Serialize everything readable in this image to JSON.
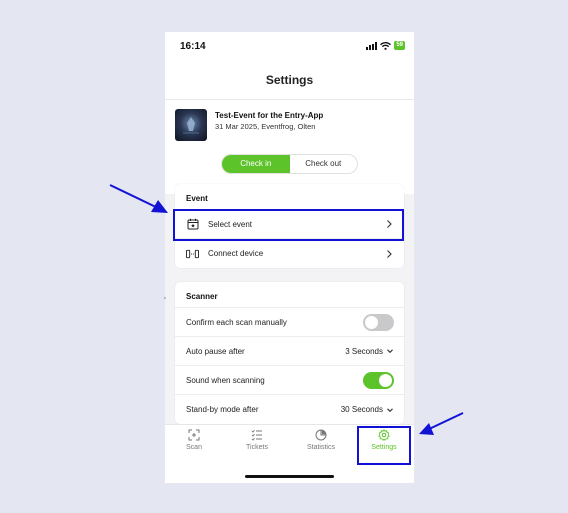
{
  "status_bar": {
    "time": "16:14",
    "battery": "59"
  },
  "header": {
    "title": "Settings"
  },
  "event": {
    "title": "Test-Event for the Entry-App",
    "subtitle": "31 Mar 2025, Eventfrog, Olten"
  },
  "segmented": {
    "checkin": "Check in",
    "checkout": "Check out",
    "selected": "checkin"
  },
  "event_section": {
    "heading": "Event",
    "items": [
      {
        "label": "Select event",
        "icon": "calendar-star-icon"
      },
      {
        "label": "Connect device",
        "icon": "connect-device-icon"
      }
    ]
  },
  "scanner_section": {
    "heading": "Scanner",
    "confirm_manual": {
      "label": "Confirm each scan manually",
      "enabled": false
    },
    "auto_pause": {
      "label": "Auto pause after",
      "value": "3 Seconds"
    },
    "sound": {
      "label": "Sound when scanning",
      "enabled": true
    },
    "standby": {
      "label": "Stand-by mode after",
      "value": "30 Seconds"
    }
  },
  "tabs": [
    {
      "label": "Scan",
      "icon": "scan-icon"
    },
    {
      "label": "Tickets",
      "icon": "tickets-list-icon"
    },
    {
      "label": "Statistics",
      "icon": "pie-chart-icon"
    },
    {
      "label": "Settings",
      "icon": "gear-icon",
      "active": true
    }
  ],
  "colors": {
    "accent": "#5dc32a",
    "highlight": "#1212d6"
  }
}
